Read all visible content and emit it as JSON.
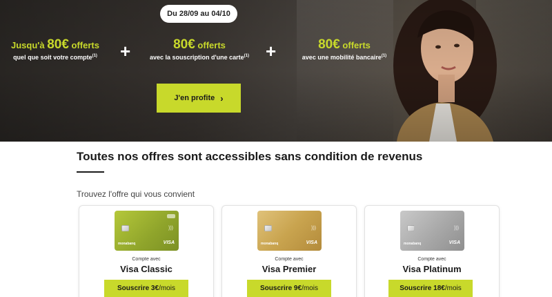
{
  "hero": {
    "date_range": "Du 28/09 au 04/10",
    "offers": [
      {
        "prefix": "Jusqu'à ",
        "amount": "80€",
        "suffix": " offerts",
        "detail": "quel que soit votre compte",
        "note": "(1)"
      },
      {
        "prefix": "",
        "amount": "80€",
        "suffix": " offerts",
        "detail": "avec la souscription d'une carte",
        "note": "(1)"
      },
      {
        "prefix": "",
        "amount": "80€",
        "suffix": " offerts",
        "detail": "avec une mobilité bancaire",
        "note": "(1)"
      }
    ],
    "plus": "+",
    "cta_label": "J'en profite"
  },
  "content": {
    "headline": "Toutes nos offres sont accessibles sans condition de revenus",
    "subhead": "Trouvez l'offre qui vous convient"
  },
  "cards": [
    {
      "account_label": "Compte avec",
      "name": "Visa Classic",
      "subscribe_prefix": "Souscrire 3€",
      "subscribe_suffix": "/mois",
      "card_bank": "monabanq",
      "card_brand": "VISA",
      "card_color": "#9ab230"
    },
    {
      "account_label": "Compte avec",
      "name": "Visa Premier",
      "subscribe_prefix": "Souscrire 9€",
      "subscribe_suffix": "/mois",
      "card_bank": "monabanq",
      "card_brand": "VISA",
      "card_color": "#c9a44f"
    },
    {
      "account_label": "Compte avec",
      "name": "Visa Platinum",
      "subscribe_prefix": "Souscrire 18€",
      "subscribe_suffix": "/mois",
      "card_bank": "monabanq",
      "card_brand": "VISA",
      "card_color": "#a8a8a8"
    }
  ],
  "colors": {
    "accent": "#c8d92b",
    "hero_dark": "#2e2a27"
  },
  "icons": {
    "cta": "chevron-right-icon",
    "contactless": "contactless-icon",
    "chip": "chip-icon"
  }
}
